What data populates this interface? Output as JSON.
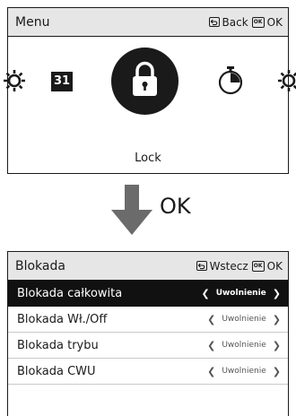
{
  "menu_screen": {
    "title": "Menu",
    "back_label": "Back",
    "ok_label": "OK",
    "calendar_number": "31",
    "selected_label": "Lock",
    "icons": [
      "gear-icon",
      "calendar-icon",
      "lock-icon",
      "timer-icon",
      "gear-icon"
    ]
  },
  "transition": {
    "label": "OK",
    "icon": "down-arrow-icon"
  },
  "lock_screen": {
    "title": "Blokada",
    "back_label": "Wstecz",
    "ok_label": "OK",
    "rows": [
      {
        "label": "Blokada całkowita",
        "value": "Uwolnienie",
        "selected": true
      },
      {
        "label": "Blokada Wł./Off",
        "value": "Uwolnienie",
        "selected": false
      },
      {
        "label": "Blokada trybu",
        "value": "Uwolnienie",
        "selected": false
      },
      {
        "label": "Blokada CWU",
        "value": "Uwolnienie",
        "selected": false
      }
    ]
  },
  "colors": {
    "header_bg": "#e6e6e6",
    "selected_row_bg": "#111111",
    "arrow": "#6b6b6b"
  }
}
